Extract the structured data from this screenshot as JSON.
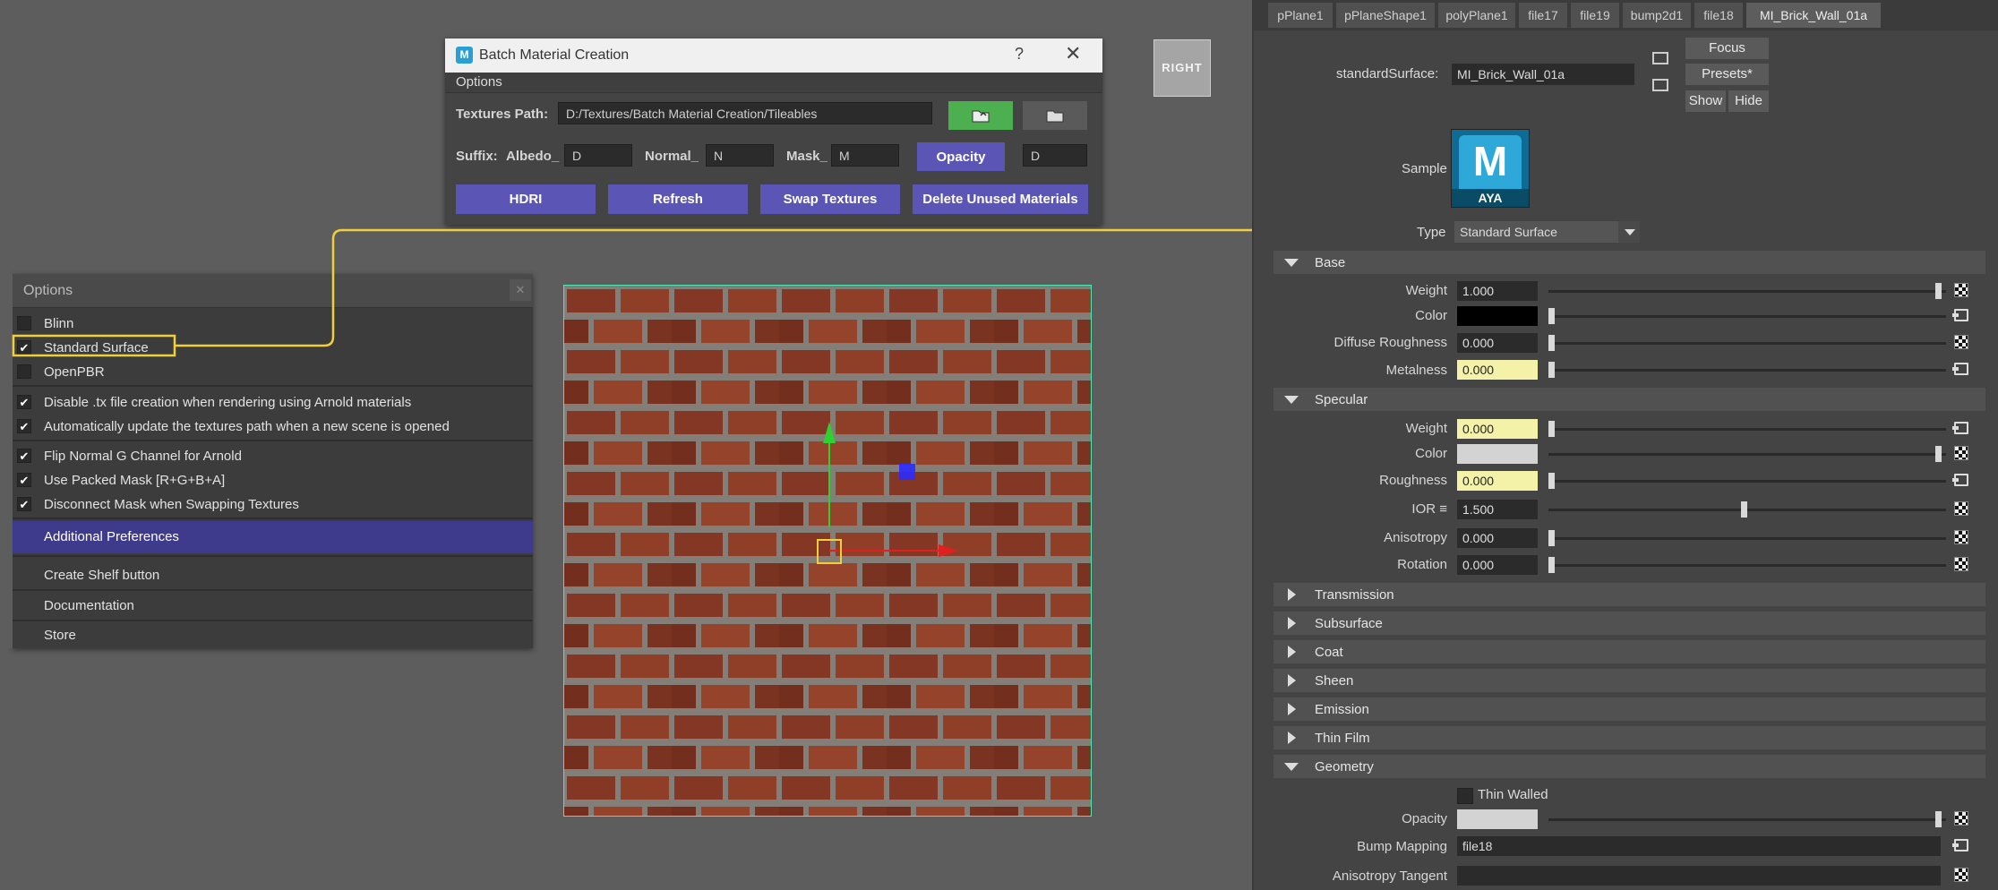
{
  "batch_window": {
    "logo": "M",
    "title": "Batch Material Creation",
    "help": "?",
    "close": "✕",
    "menu": "Options",
    "textures_path_label": "Textures Path:",
    "textures_path_value": "D:/Textures/Batch Material Creation/Tileables",
    "suffix_label": "Suffix:",
    "albedo_label": "Albedo_",
    "albedo_value": "D",
    "normal_label": "Normal_",
    "normal_value": "N",
    "mask_label": "Mask_",
    "mask_value": "M",
    "opacity_button": "Opacity",
    "opacity_value": "D",
    "hdri_button": "HDRI",
    "refresh_button": "Refresh",
    "swap_button": "Swap Textures",
    "delete_button": "Delete Unused Materials"
  },
  "view_cube": {
    "label": "RIGHT"
  },
  "options_panel": {
    "title": "Options",
    "close": "✕",
    "items": [
      {
        "label": "Blinn",
        "checked": false
      },
      {
        "label": "Standard Surface",
        "checked": true
      },
      {
        "label": "OpenPBR",
        "checked": false
      },
      {
        "label": "Disable .tx file creation when rendering using Arnold materials",
        "checked": true
      },
      {
        "label": "Automatically update the textures path when a new scene is opened",
        "checked": true
      },
      {
        "label": "Flip Normal G Channel for Arnold",
        "checked": true
      },
      {
        "label": "Use Packed Mask [R+G+B+A]",
        "checked": true
      },
      {
        "label": "Disconnect Mask when Swapping Textures",
        "checked": true
      }
    ],
    "additional_preferences": "Additional Preferences",
    "create_shelf": "Create Shelf button",
    "documentation": "Documentation",
    "store": "Store"
  },
  "attribute_editor": {
    "tabs": [
      "pPlane1",
      "pPlaneShape1",
      "polyPlane1",
      "file17",
      "file19",
      "bump2d1",
      "file18",
      "MI_Brick_Wall_01a"
    ],
    "active_tab": "MI_Brick_Wall_01a",
    "shader_label": "standardSurface:",
    "shader_name": "MI_Brick_Wall_01a",
    "focus": "Focus",
    "presets": "Presets*",
    "show": "Show",
    "hide": "Hide",
    "sample_label": "Sample",
    "sample_logo_big": "M",
    "sample_logo_small": "AYA",
    "type_label": "Type",
    "type_value": "Standard Surface",
    "sections": {
      "base": "Base",
      "specular": "Specular",
      "transmission": "Transmission",
      "subsurface": "Subsurface",
      "coat": "Coat",
      "sheen": "Sheen",
      "emission": "Emission",
      "thin_film": "Thin Film",
      "geometry": "Geometry"
    },
    "base": {
      "weight_label": "Weight",
      "weight": "1.000",
      "color_label": "Color",
      "diffuse_roughness_label": "Diffuse Roughness",
      "diffuse_roughness": "0.000",
      "metalness_label": "Metalness",
      "metalness": "0.000"
    },
    "specular": {
      "weight_label": "Weight",
      "weight": "0.000",
      "color_label": "Color",
      "roughness_label": "Roughness",
      "roughness": "0.000",
      "ior_label": "IOR ≡",
      "ior": "1.500",
      "anisotropy_label": "Anisotropy",
      "anisotropy": "0.000",
      "rotation_label": "Rotation",
      "rotation": "0.000"
    },
    "geometry": {
      "thin_walled": "Thin Walled",
      "opacity_label": "Opacity",
      "bump_mapping_label": "Bump Mapping",
      "bump_mapping": "file18",
      "anisotropy_tangent_label": "Anisotropy Tangent"
    }
  },
  "colors": {
    "accent_purple": "#5b56b5",
    "green_button": "#4caf50",
    "highlight_yellow": "#f4f2a8",
    "annotation_yellow": "#f0cf3c",
    "selection_green": "#49e8b0"
  }
}
